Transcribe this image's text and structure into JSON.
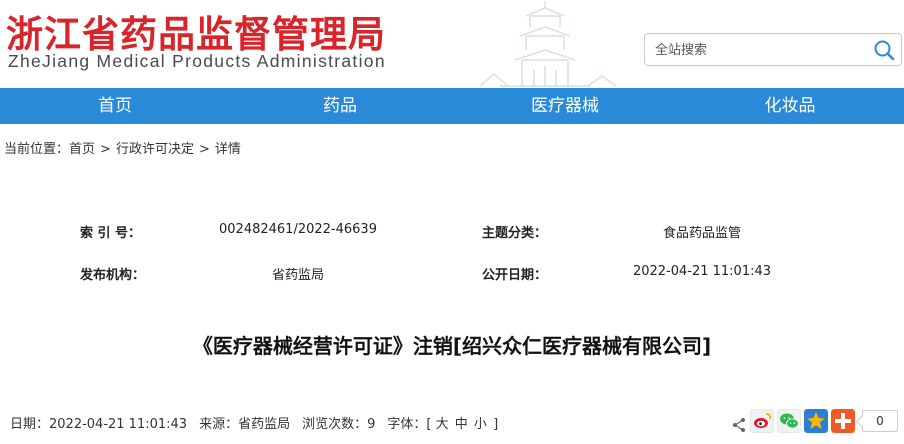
{
  "header": {
    "logo_cn": "浙江省药品监督管理局",
    "logo_en": "ZheJiang Medical Products Administration",
    "search_placeholder": "全站搜索"
  },
  "nav": {
    "items": [
      "首页",
      "药品",
      "医疗器械",
      "化妆品"
    ]
  },
  "breadcrumb": {
    "prefix": "当前位置：",
    "items": [
      "首页",
      "行政许可决定",
      "详情"
    ],
    "separator": ">"
  },
  "meta": {
    "index_label": "索 引 号：",
    "index_value": "002482461/2022-46639",
    "category_label": "主题分类：",
    "category_value": "食品药品监管",
    "publisher_label": "发布机构：",
    "publisher_value": "省药监局",
    "date_label": "公开日期：",
    "date_value": "2022-04-21 11:01:43"
  },
  "article": {
    "title": "《医疗器械经营许可证》注销[绍兴众仁医疗器械有限公司]"
  },
  "info": {
    "date": "日期：2022-04-21 11:01:43",
    "source": "来源：省药监局",
    "views": "浏览次数：9",
    "font_label": "字体：[",
    "font_large": "大",
    "font_medium": "中",
    "font_small": "小",
    "font_close": "]"
  },
  "share": {
    "count": "0",
    "icons": [
      "share-icon",
      "weibo-icon",
      "wechat-icon",
      "qzone-icon",
      "more-icon"
    ],
    "colors": {
      "weibo": "#e6162d",
      "wechat": "#2db94d",
      "qzone": "#f7b500",
      "more": "#f05a28"
    }
  },
  "colors": {
    "brand_red": "#d8252b",
    "nav_blue": "#2b8ad8"
  }
}
